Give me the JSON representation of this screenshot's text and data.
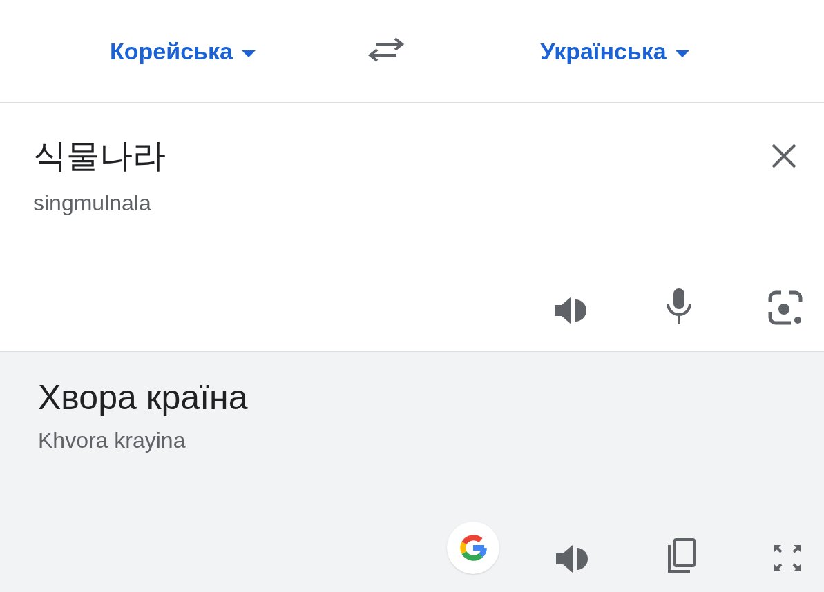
{
  "languages": {
    "source": "Корейська",
    "target": "Українська"
  },
  "input": {
    "text": "식물나라",
    "transliteration": "singmulnala"
  },
  "output": {
    "text": "Хвора країна",
    "transliteration": "Khvora krayina"
  }
}
